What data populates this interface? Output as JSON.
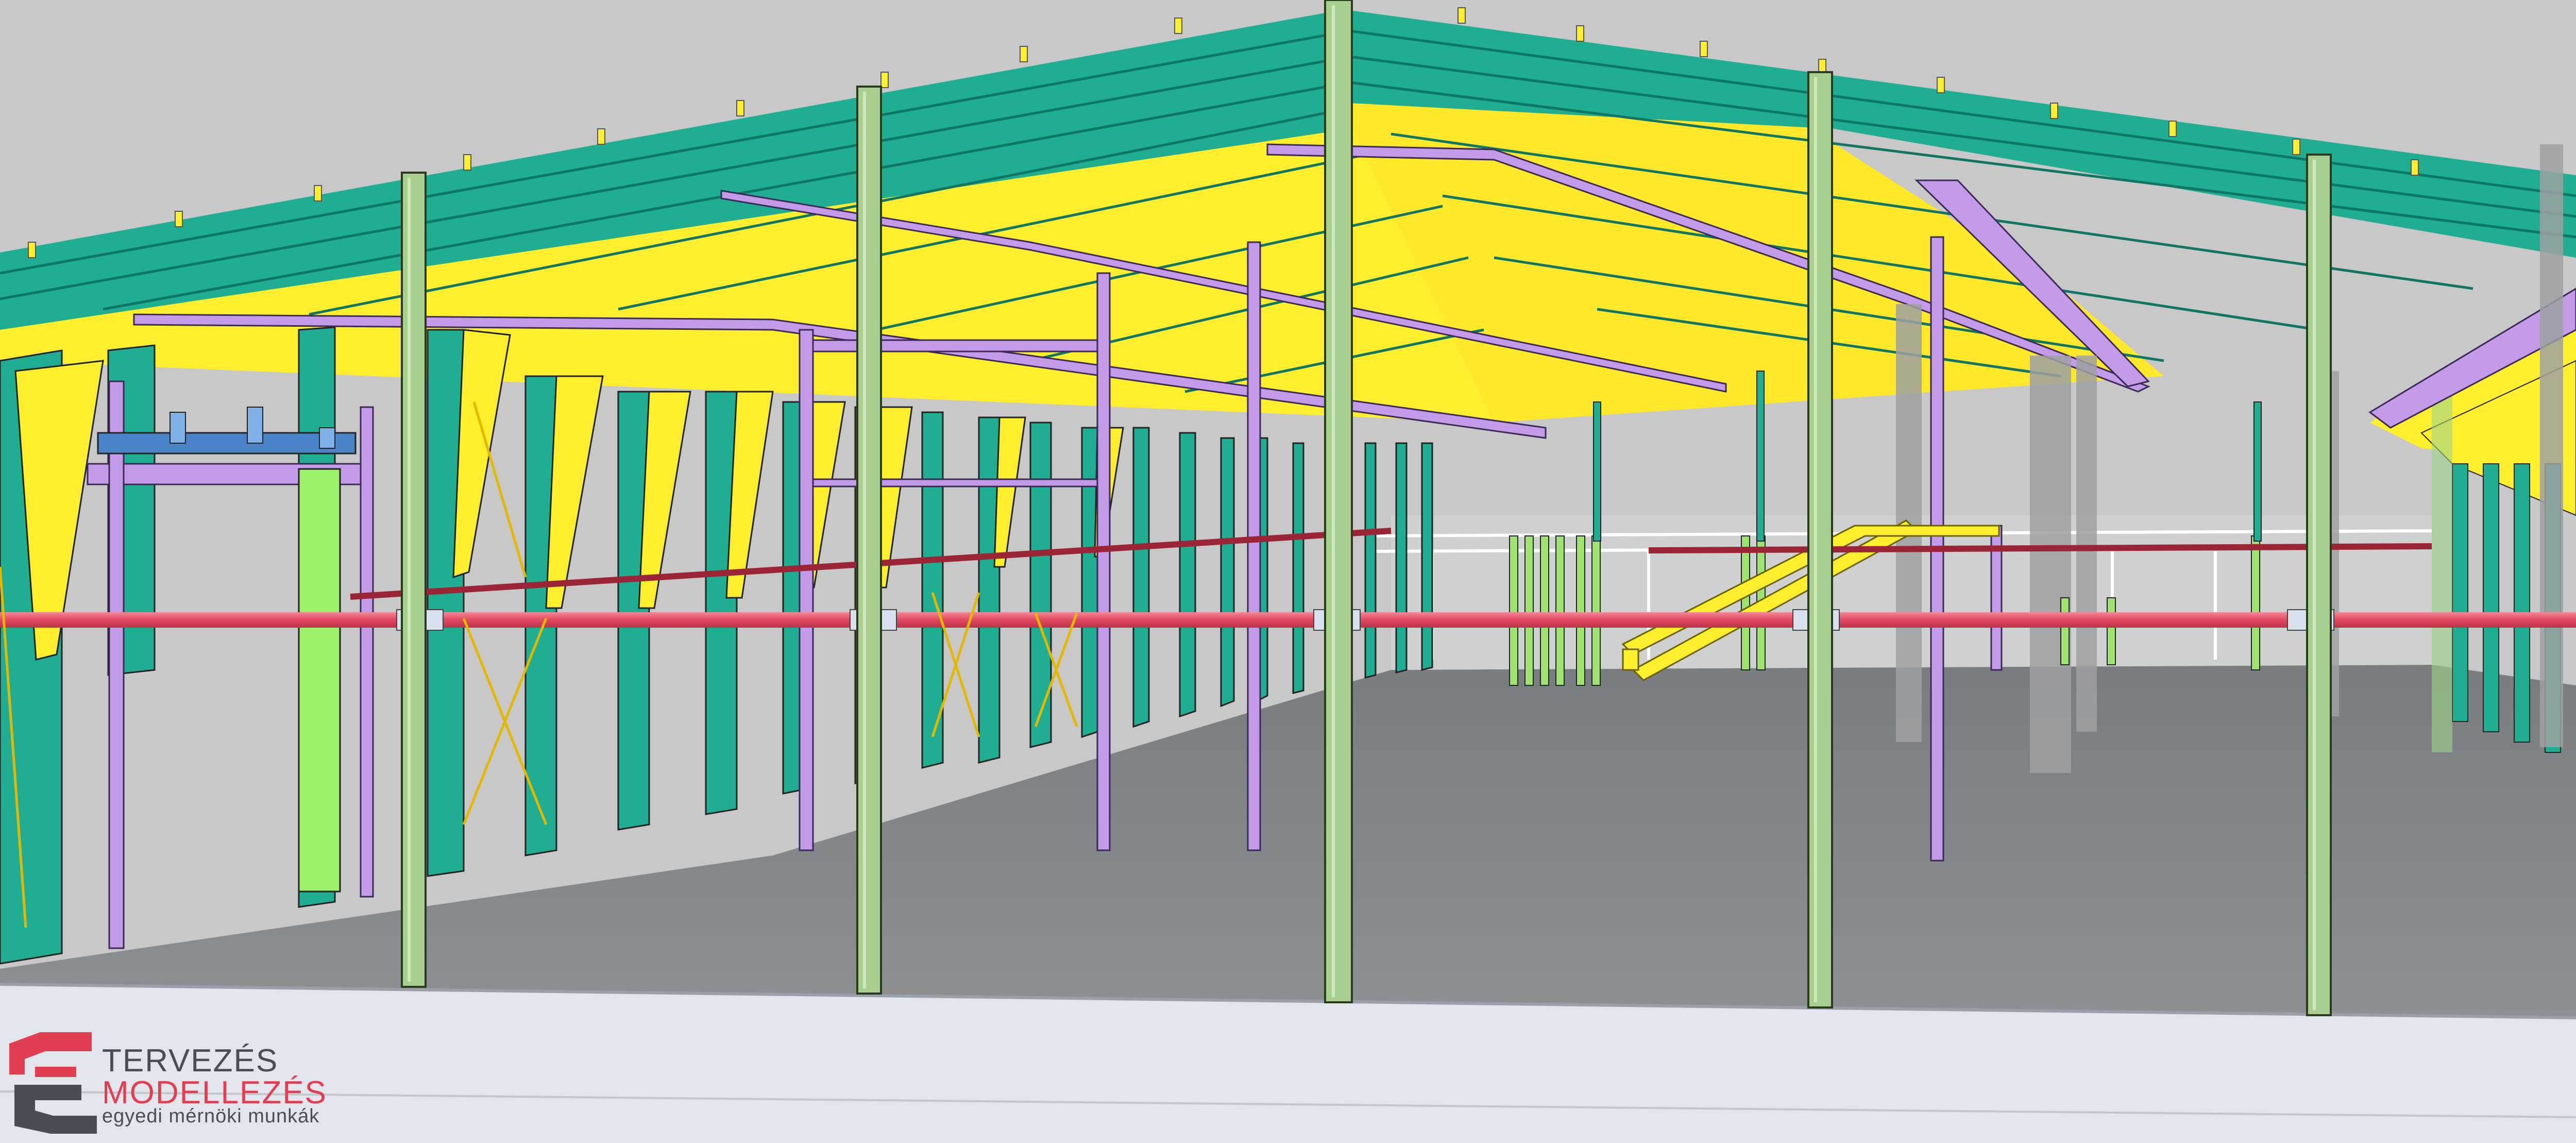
{
  "image": {
    "subject": "3D steel hall structure model",
    "colors": {
      "background": "#c8c8c8",
      "roof_beam": "#1fae92",
      "roof_underside": "#ffee2e",
      "column_front": "#a8cf8e",
      "column_wall": "#1fae92",
      "secondary_member": "#c49be8",
      "pipe": "#e85a6e",
      "floor": "#85888a",
      "slab_edge": "#dfe3ea",
      "bracing": "#e3b800",
      "brand_red": "#e23e52",
      "brand_grey": "#4a4d55"
    }
  },
  "logo": {
    "line1": "TERVEZÉS",
    "line2": "MODELLEZÉS",
    "line3": "egyedi mérnöki munkák",
    "icon": "te-monogram-icon"
  }
}
